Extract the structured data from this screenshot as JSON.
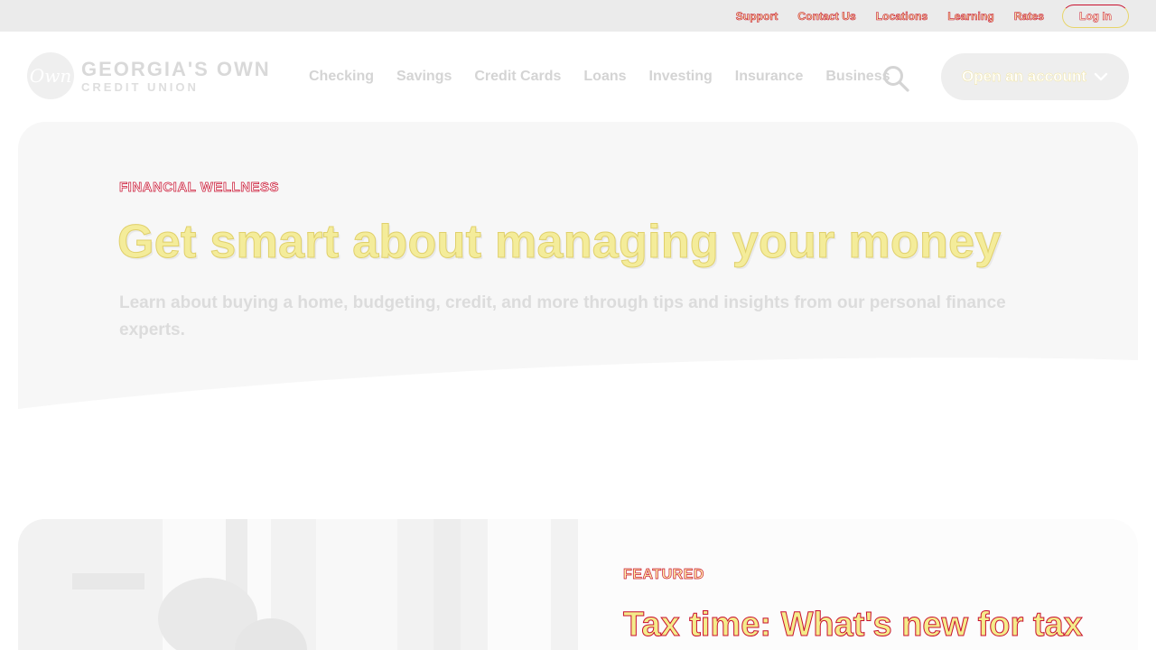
{
  "utility_nav": {
    "links": [
      "Support",
      "Contact Us",
      "Locations",
      "Learning",
      "Rates"
    ],
    "login_label": "Log In"
  },
  "brand": {
    "logo_mark": "Own",
    "name_line1": "GEORGIA'S OWN",
    "name_line2": "CREDIT UNION"
  },
  "primary_nav": {
    "items": [
      "Checking",
      "Savings",
      "Credit Cards",
      "Loans",
      "Investing",
      "Insurance",
      "Business"
    ],
    "search_icon": "search-icon",
    "cta_label": "Open an account",
    "cta_icon": "chevron-down-icon"
  },
  "hero": {
    "eyebrow": "FINANCIAL WELLNESS",
    "title": "Get smart about managing your money",
    "description": "Learn about buying a home, budgeting, credit, and more through tips and insights from our personal finance experts."
  },
  "featured": {
    "eyebrow": "FEATURED",
    "title": "Tax time: What's new for tax"
  },
  "colors": {
    "brand_red": "#c8102e",
    "highlight_yellow": "#f4ec9a",
    "utility_bar": "#ebebeb",
    "hero_bg": "#f7f7f7"
  }
}
